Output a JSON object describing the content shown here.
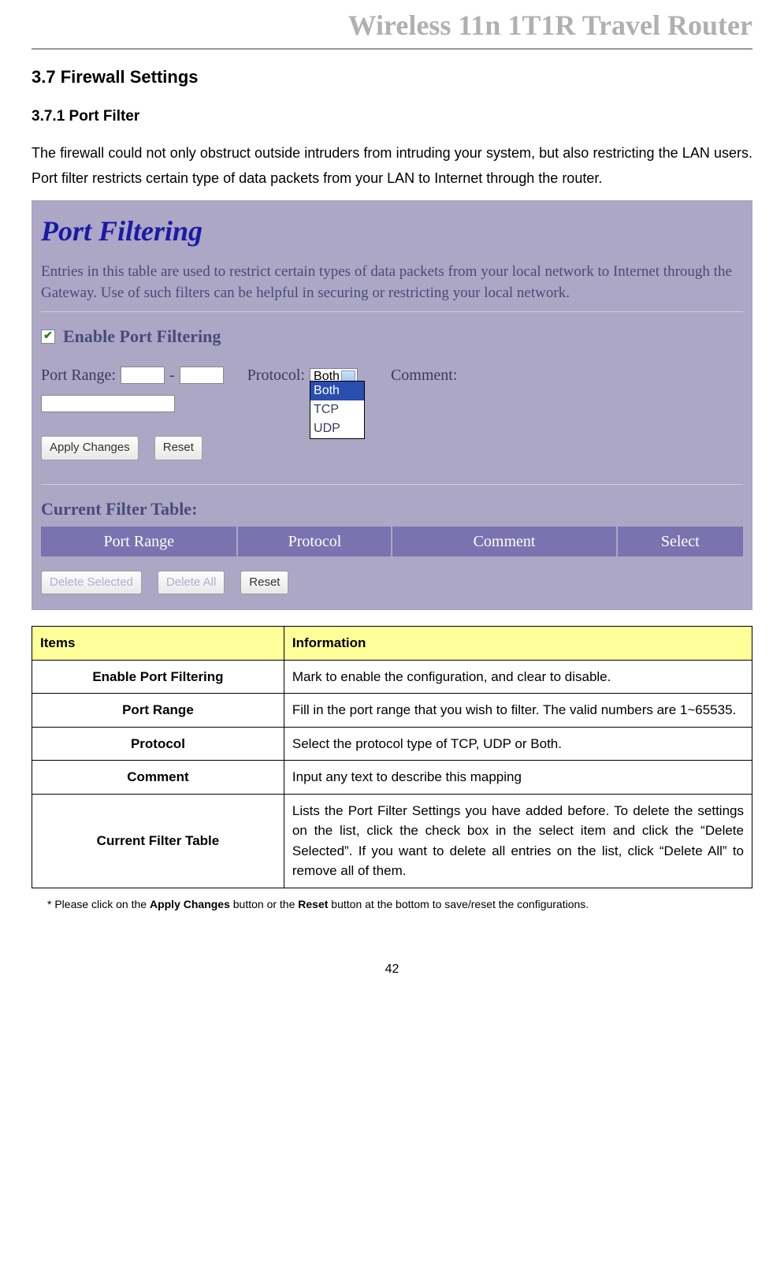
{
  "header": {
    "title": "Wireless 11n 1T1R Travel Router"
  },
  "section": {
    "num_title": "3.7   Firewall Settings",
    "sub_num_title": "3.7.1  Port Filter",
    "intro": "The firewall could not only obstruct outside intruders from intruding your system, but also restricting the LAN users. Port filter restricts certain type of data packets from your LAN to Internet through the router."
  },
  "screenshot": {
    "title": "Port Filtering",
    "desc": "Entries in this table are used to restrict certain types of data packets from your local network to Internet through the Gateway. Use of such filters can be helpful in securing or restricting your local network.",
    "enable_label": "Enable Port Filtering",
    "port_range_label": "Port Range:",
    "dash": "-",
    "protocol_label": "Protocol:",
    "protocol_selected": "Both",
    "protocol_options": [
      "Both",
      "TCP",
      "UDP"
    ],
    "comment_label": "Comment:",
    "apply_btn": "Apply Changes",
    "reset_btn": "Reset",
    "table_title": "Current Filter Table:",
    "cols": [
      "Port Range",
      "Protocol",
      "Comment",
      "Select"
    ],
    "del_sel_btn": "Delete Selected",
    "del_all_btn": "Delete All",
    "reset2_btn": "Reset"
  },
  "info_table": {
    "hdr_items": "Items",
    "hdr_info": "Information",
    "rows": [
      {
        "item": "Enable Port Filtering",
        "info": "Mark to enable the configuration, and clear to disable."
      },
      {
        "item": "Port Range",
        "info": "Fill in the port range that you wish to filter. The valid numbers are 1~65535."
      },
      {
        "item": "Protocol",
        "info": "Select the protocol type of TCP, UDP or Both."
      },
      {
        "item": "Comment",
        "info": "Input any text to describe this mapping"
      },
      {
        "item": "Current Filter Table",
        "info": "Lists the Port Filter Settings you have added before. To delete the settings on the list, click the check box in the select item and click the “Delete Selected”. If you want to delete all entries on the list, click “Delete All” to remove all of them."
      }
    ]
  },
  "footnote": {
    "prefix": "* Please click on the ",
    "b1": "Apply Changes",
    "mid": " button or the ",
    "b2": "Reset",
    "suffix": " button at the bottom to save/reset the configurations."
  },
  "page": "42"
}
